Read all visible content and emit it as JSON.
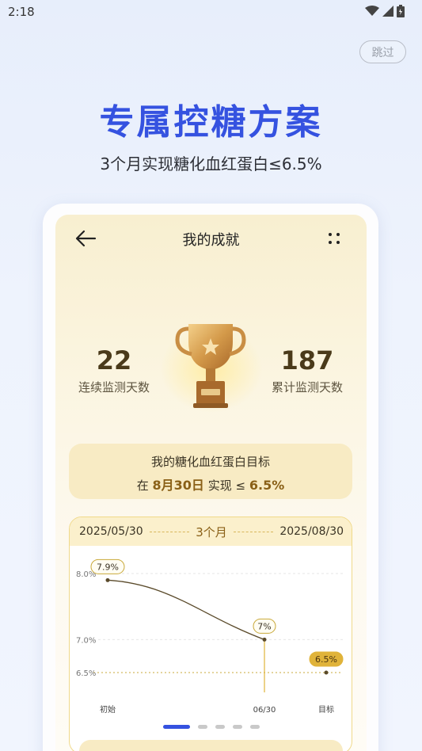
{
  "status": {
    "time": "2:18"
  },
  "skip_label": "跳过",
  "hero": {
    "title": "专属控糖方案",
    "subtitle": "3个月实现糖化血红蛋白≤6.5%"
  },
  "screen": {
    "title": "我的成就",
    "stats": [
      {
        "value": "22",
        "label": "连续监测天数"
      },
      {
        "value": "187",
        "label": "累计监测天数"
      }
    ],
    "goal": {
      "title": "我的糖化血红蛋白目标",
      "prefix": "在",
      "date": "8月30日",
      "middle": "实现",
      "symbol": "≤",
      "target": "6.5%"
    },
    "chart_header": {
      "start": "2025/05/30",
      "period": "3个月",
      "end": "2025/08/30"
    },
    "pager": {
      "count": 5,
      "active": 0
    }
  },
  "chart_data": {
    "type": "line",
    "categories": [
      "初始",
      "06/30",
      "目标"
    ],
    "y_ticks": [
      "8.0%",
      "7.0%",
      "6.5%"
    ],
    "series": [
      {
        "values": [
          7.9,
          7.0,
          6.5
        ],
        "labels": [
          "7.9%",
          "7%",
          "6.5%"
        ]
      }
    ],
    "ylim": [
      6.2,
      8.3
    ],
    "target_line": 6.5,
    "colors": {
      "line": "#5a4a2a",
      "target_badge": "#e0b33a",
      "grid": "#e6e6e6",
      "target_line": "#c9a93a"
    }
  }
}
